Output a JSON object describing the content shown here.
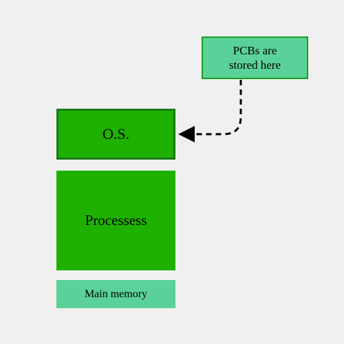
{
  "callout": {
    "text": "PCBs are\nstored here"
  },
  "os": {
    "label": "O.S."
  },
  "processes": {
    "label": "Processess"
  },
  "main_memory": {
    "label": "Main memory"
  },
  "colors": {
    "background": "#f0f0f0",
    "box_green": "#1eb100",
    "box_border": "#177a17",
    "light_green": "#5ad198",
    "light_green_border": "#1a9e1a",
    "arrow": "#000000"
  }
}
